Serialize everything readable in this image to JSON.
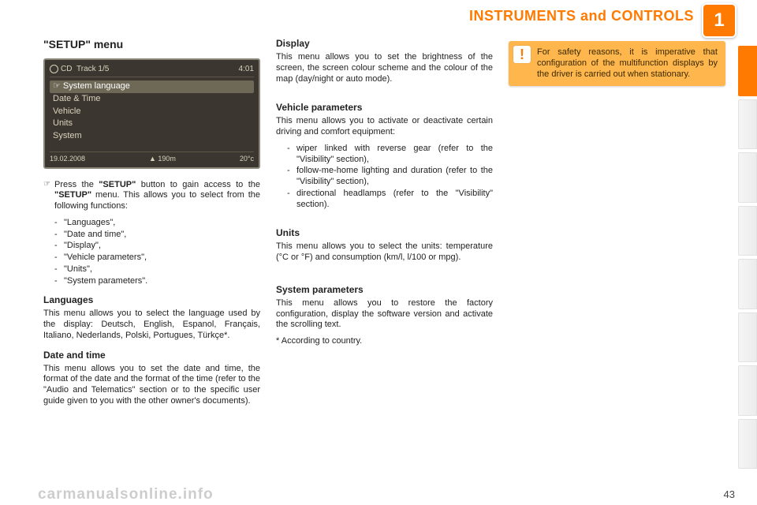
{
  "header": {
    "section_title": "INSTRUMENTS and CONTROLS",
    "chapter_number": "1",
    "page_number": "43",
    "watermark": "carmanualsonline.info"
  },
  "col1": {
    "title": "\"SETUP\" menu",
    "screenshot": {
      "top_left": "CD",
      "top_mid": "Track 1/5",
      "top_right": "4:01",
      "selected": "System language",
      "items": [
        "Date & Time",
        "Vehicle",
        "Units",
        "System"
      ],
      "foot_left": "19.02.2008",
      "foot_mid": "▲ 190m",
      "foot_right": "20°c"
    },
    "press_lead": "Press the ",
    "press_bold1": "\"SETUP\"",
    "press_mid": " button to gain access to the ",
    "press_bold2": "\"SETUP\"",
    "press_tail": " menu. This allows you to select from the following functions:",
    "functions": [
      "\"Languages\",",
      "\"Date and time\",",
      "\"Display\",",
      "\"Vehicle parameters\",",
      "\"Units\",",
      "\"System parameters\"."
    ],
    "languages_h": "Languages",
    "languages_p": "This menu allows you to select the language used by the display: Deutsch, English, Espanol, Français, Italiano, Nederlands, Polski, Portugues, Türkçe*.",
    "datetime_h": "Date and time",
    "datetime_p": "This menu allows you to set the date and time, the format of the date and the format of the time (refer to the \"Audio and Telematics\" section or to the specific user guide given to you with the other owner's documents)."
  },
  "col2": {
    "display_h": "Display",
    "display_p": "This menu allows you to set the brightness of the screen, the screen colour scheme and the colour of the map (day/night or auto mode).",
    "vparam_h": "Vehicle parameters",
    "vparam_p": "This menu allows you to activate or deactivate certain driving and comfort equipment:",
    "vparam_list": [
      "wiper linked with reverse gear (refer to the \"Visibility\" section),",
      "follow-me-home lighting and duration (refer to the \"Visibility\" section),",
      "directional headlamps (refer to the \"Visibility\" section)."
    ],
    "units_h": "Units",
    "units_p": "This menu allows you to select the units: temperature (°C or °F) and consumption (km/l, l/100 or mpg).",
    "sparam_h": "System parameters",
    "sparam_p": "This menu allows you to restore the factory configuration, display the software version and activate the scrolling text.",
    "footnote": "* According to country."
  },
  "col3": {
    "warning": "For safety reasons, it is imperative that configuration of the multifunction displays by the driver is carried out when stationary.",
    "warning_icon": "!"
  }
}
